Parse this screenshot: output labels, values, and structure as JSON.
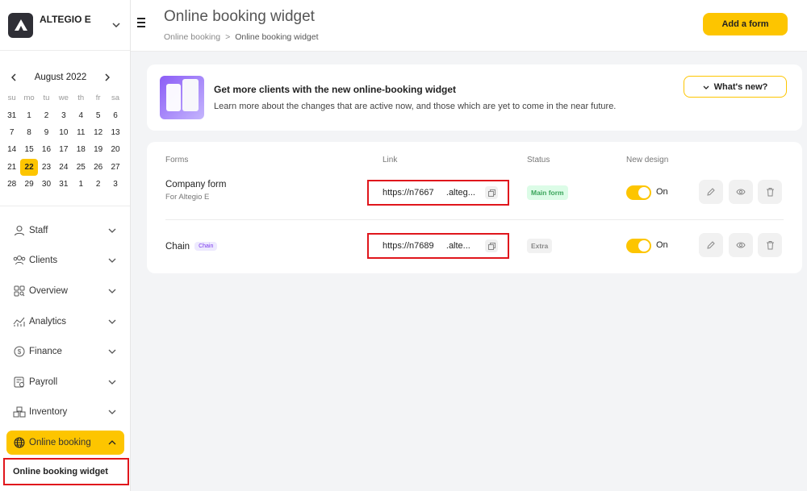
{
  "sidebar": {
    "brand": "ALTEGIO E",
    "calendar": {
      "month": "August 2022",
      "weekdays": [
        "su",
        "mo",
        "tu",
        "we",
        "th",
        "fr",
        "sa"
      ],
      "days": [
        [
          "31",
          "1",
          "2",
          "3",
          "4",
          "5",
          "6"
        ],
        [
          "7",
          "8",
          "9",
          "10",
          "11",
          "12",
          "13"
        ],
        [
          "14",
          "15",
          "16",
          "17",
          "18",
          "19",
          "20"
        ],
        [
          "21",
          "22",
          "23",
          "24",
          "25",
          "26",
          "27"
        ],
        [
          "28",
          "29",
          "30",
          "31",
          "1",
          "2",
          "3"
        ]
      ],
      "selected": "22"
    },
    "menu": [
      {
        "label": "Staff",
        "icon": "person-icon"
      },
      {
        "label": "Clients",
        "icon": "users-icon"
      },
      {
        "label": "Overview",
        "icon": "overview-icon"
      },
      {
        "label": "Analytics",
        "icon": "analytics-icon"
      },
      {
        "label": "Finance",
        "icon": "finance-icon"
      },
      {
        "label": "Payroll",
        "icon": "payroll-icon"
      },
      {
        "label": "Inventory",
        "icon": "inventory-icon"
      },
      {
        "label": "Online booking",
        "icon": "globe-icon"
      }
    ],
    "submenu_item": "Online booking widget"
  },
  "header": {
    "title": "Online booking widget",
    "breadcrumb": [
      "Online booking",
      "Online booking widget"
    ],
    "breadcrumb_separator": ">",
    "add_button": "Add a form"
  },
  "promo": {
    "title": "Get more clients with the new online-booking widget",
    "text": "Learn more about the changes that are active now, and those which are yet to come in the near future.",
    "button": "What's new?"
  },
  "table": {
    "columns": [
      "Forms",
      "Link",
      "Status",
      "New design"
    ],
    "rows": [
      {
        "name": "Company form",
        "sub": "For Altegio E",
        "badge": "",
        "link": "https://n7667     .alteg...",
        "status": "Main form",
        "toggle": "On"
      },
      {
        "name": "Chain",
        "sub": "",
        "badge": "Chain",
        "link": "https://n7689     .alte...",
        "status": "Extra",
        "toggle": "On"
      }
    ]
  },
  "colors": {
    "accent": "#fdc500",
    "highlight": "#e0161c"
  }
}
